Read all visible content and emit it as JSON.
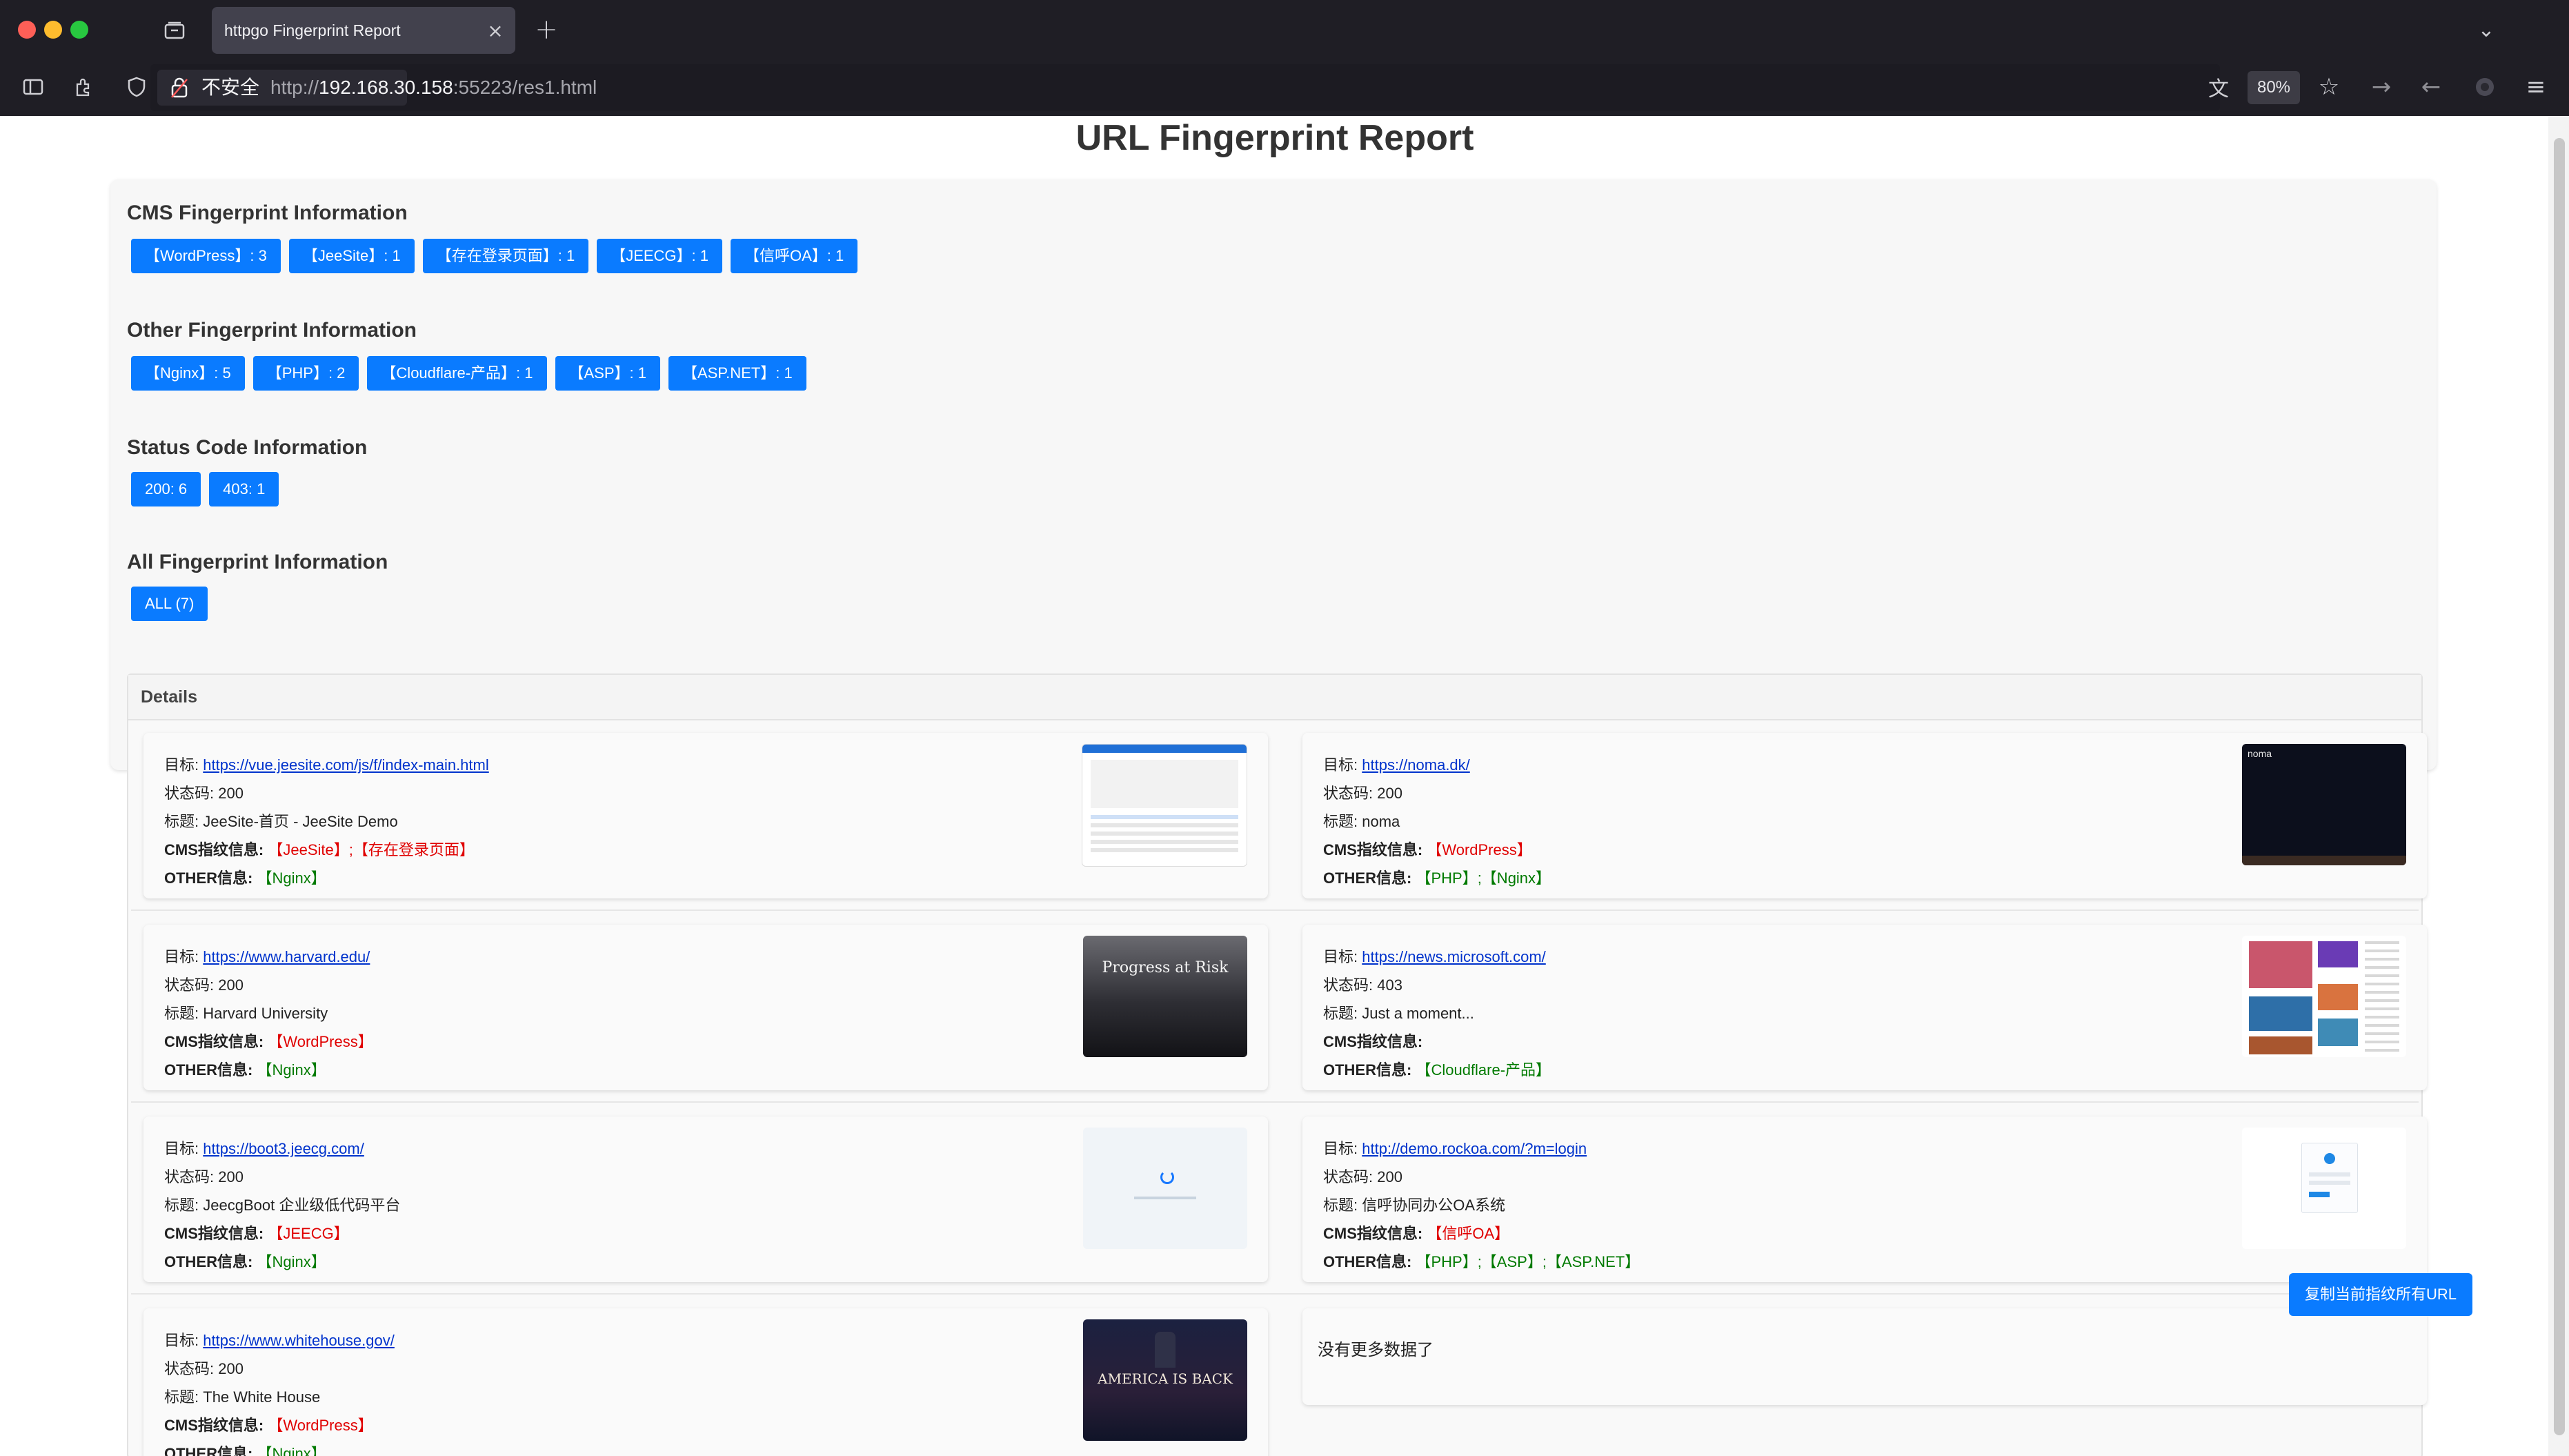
{
  "browser": {
    "tab_title": "httpgo Fingerprint Report",
    "insecure_label": "不安全",
    "url_scheme": "http://",
    "url_host": "192.168.30.158",
    "url_rest": ":55223/res1.html",
    "zoom": "80%"
  },
  "page": {
    "title": "URL Fingerprint Report",
    "sections": [
      {
        "heading": "CMS Fingerprint Information",
        "badges": [
          "【WordPress】: 3",
          "【JeeSite】: 1",
          "【存在登录页面】: 1",
          "【JEECG】: 1",
          "【信呼OA】: 1"
        ]
      },
      {
        "heading": "Other Fingerprint Information",
        "badges": [
          "【Nginx】: 5",
          "【PHP】: 2",
          "【Cloudflare-产品】: 1",
          "【ASP】: 1",
          "【ASP.NET】: 1"
        ]
      },
      {
        "heading": "Status Code Information",
        "badges": [
          "200: 6",
          "403: 1"
        ]
      },
      {
        "heading": "All Fingerprint Information",
        "badges": [
          "ALL (7)"
        ]
      }
    ],
    "details_title": "Details",
    "labels": {
      "target": "目标:",
      "status": "状态码:",
      "title": "标题:",
      "cms": "CMS指纹信息:",
      "other": "OTHER信息:"
    },
    "cards": [
      {
        "url": "https://vue.jeesite.com/js/f/index-main.html",
        "status": "200",
        "title": "JeeSite-首页 - JeeSite Demo",
        "cms": "【JeeSite】;【存在登录页面】",
        "other": "【Nginx】"
      },
      {
        "url": "https://noma.dk/",
        "status": "200",
        "title": "noma",
        "cms": "【WordPress】",
        "other": "【PHP】;【Nginx】"
      },
      {
        "url": "https://www.harvard.edu/",
        "status": "200",
        "title": "Harvard University",
        "cms": "【WordPress】",
        "other": "【Nginx】"
      },
      {
        "url": "https://news.microsoft.com/",
        "status": "403",
        "title": "Just a moment...",
        "cms": "",
        "other": "【Cloudflare-产品】"
      },
      {
        "url": "https://boot3.jeecg.com/",
        "status": "200",
        "title": "JeecgBoot 企业级低代码平台",
        "cms": "【JEECG】",
        "other": "【Nginx】"
      },
      {
        "url": "http://demo.rockoa.com/?m=login",
        "status": "200",
        "title": "信呼协同办公OA系统",
        "cms": "【信呼OA】",
        "other": "【PHP】;【ASP】;【ASP.NET】"
      },
      {
        "url": "https://www.whitehouse.gov/",
        "status": "200",
        "title": "The White House",
        "cms": "【WordPress】",
        "other": "【Nginx】"
      }
    ],
    "thumb_texts": {
      "noma": "noma",
      "harvard": "Progress at Risk",
      "whitehouse": "AMERICA IS BACK"
    },
    "no_more": "没有更多数据了",
    "copy_button": "复制当前指纹所有URL"
  },
  "colors": {
    "badge_blue": "#0a7bff",
    "cms_red": "#e00000",
    "other_green": "#007a00",
    "link_blue": "#0033cc"
  }
}
